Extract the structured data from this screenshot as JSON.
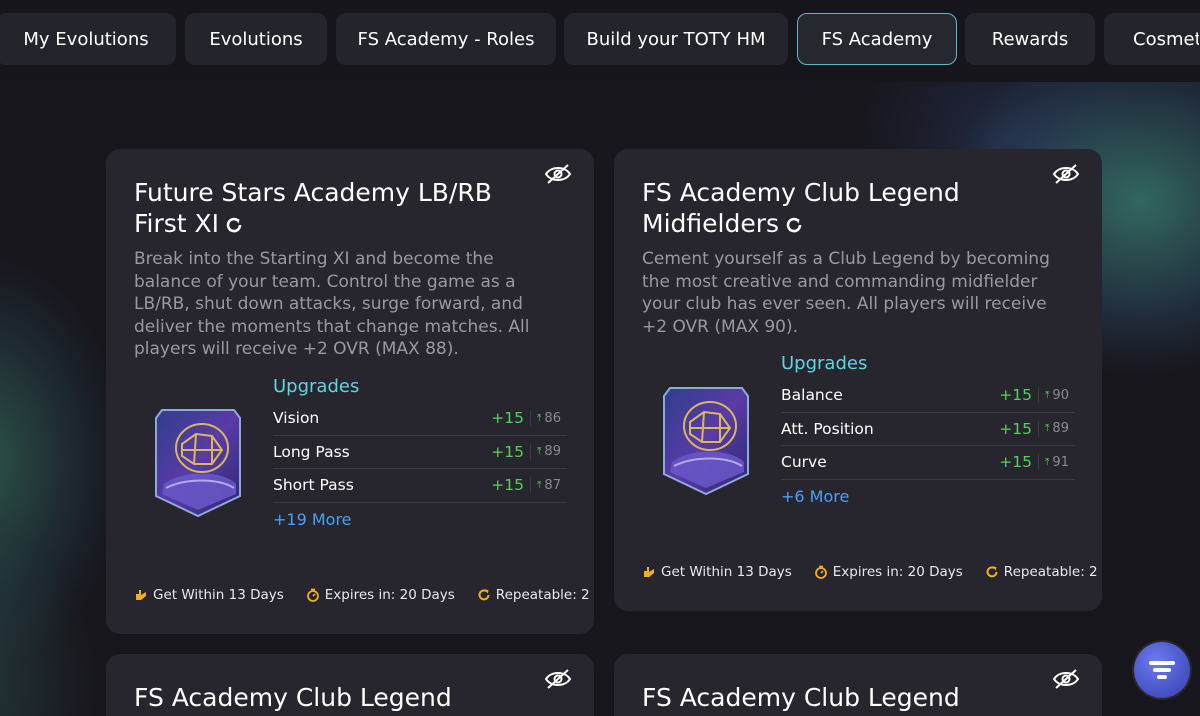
{
  "tabs": [
    {
      "label": "My Evolutions",
      "active": false
    },
    {
      "label": "Evolutions",
      "active": false
    },
    {
      "label": "FS Academy - Roles",
      "active": false
    },
    {
      "label": "Build your TOTY HM",
      "active": false
    },
    {
      "label": "FS Academy",
      "active": true
    },
    {
      "label": "Rewards",
      "active": false
    },
    {
      "label": "Cosmetics",
      "active": false
    }
  ],
  "cards": [
    {
      "title": "Future Stars Academy LB/RB First XI",
      "description": "Break into the Starting XI and become the balance of your team. Control the game as a LB/RB, shut down attacks, surge forward, and deliver the moments that change matches. All players will receive +2 OVR (MAX 88).",
      "upgrades_title": "Upgrades",
      "upgrades": [
        {
          "name": "Vision",
          "value": "+15",
          "max": "86"
        },
        {
          "name": "Long Pass",
          "value": "+15",
          "max": "89"
        },
        {
          "name": "Short Pass",
          "value": "+15",
          "max": "87"
        }
      ],
      "more": "+19 More",
      "get_within": "Get Within 13 Days",
      "expires": "Expires in: 20 Days",
      "repeatable": "Repeatable: 2"
    },
    {
      "title": "FS Academy Club Legend Midfielders",
      "description": "Cement yourself as a Club Legend by becoming the most creative and commanding midfielder your club has ever seen. All players will receive +2 OVR (MAX 90).",
      "upgrades_title": "Upgrades",
      "upgrades": [
        {
          "name": "Balance",
          "value": "+15",
          "max": "90"
        },
        {
          "name": "Att. Position",
          "value": "+15",
          "max": "89"
        },
        {
          "name": "Curve",
          "value": "+15",
          "max": "91"
        }
      ],
      "more": "+6 More",
      "get_within": "Get Within 13 Days",
      "expires": "Expires in: 20 Days",
      "repeatable": "Repeatable: 2"
    },
    {
      "title": "FS Academy Club Legend"
    },
    {
      "title": "FS Academy Club Legend"
    }
  ],
  "colors": {
    "accent_cyan": "#5fd4e2",
    "upgrade_green": "#54d05a",
    "link_blue": "#4a9ff5",
    "active_tab_border": "#5fb8c8"
  },
  "icons": {
    "hide": "eye-slash-icon",
    "refresh": "refresh-icon",
    "get_within": "hand-pointer-icon",
    "expires": "stopwatch-icon",
    "repeatable": "repeat-icon",
    "max": "max-arrow-icon",
    "filter": "filter-icon"
  }
}
